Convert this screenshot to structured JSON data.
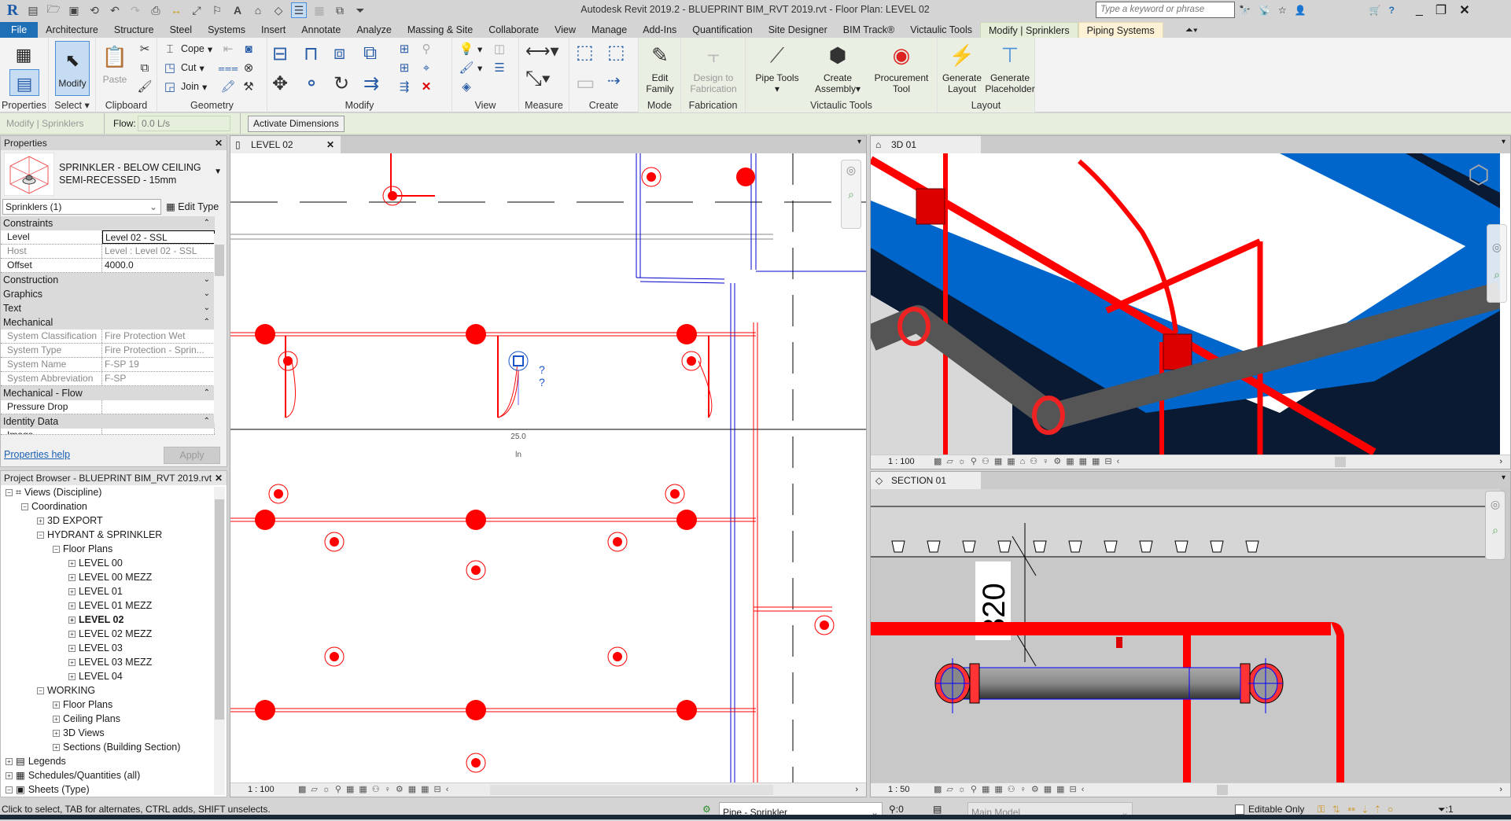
{
  "app": {
    "title": "Autodesk Revit 2019.2 - BLUEPRINT BIM_RVT 2019.rvt - Floor Plan: LEVEL 02",
    "search_placeholder": "Type a keyword or phrase"
  },
  "tabs": [
    "File",
    "Architecture",
    "Structure",
    "Steel",
    "Systems",
    "Insert",
    "Annotate",
    "Analyze",
    "Massing & Site",
    "Collaborate",
    "View",
    "Manage",
    "Add-Ins",
    "Quantification",
    "Site Designer",
    "BIM Track®",
    "Victaulic Tools",
    "Modify | Sprinklers",
    "Piping Systems"
  ],
  "ribbon": {
    "properties_label": "Properties",
    "modify_label": "Modify",
    "select_label": "Select",
    "paste_label": "Paste",
    "clipboard_label": "Clipboard",
    "cope_label": "Cope",
    "cut_label": "Cut",
    "join_label": "Join",
    "geometry_label": "Geometry",
    "modify_panel_label": "Modify",
    "view_label": "View",
    "measure_label": "Measure",
    "create_label": "Create",
    "edit_family_1": "Edit",
    "edit_family_2": "Family",
    "mode_label": "Mode",
    "design_fab_1": "Design to",
    "design_fab_2": "Fabrication",
    "fabrication_label": "Fabrication",
    "pipe_tools": "Pipe Tools",
    "create_assembly_1": "Create",
    "create_assembly_2": "Assembly",
    "procurement_1": "Procurement",
    "procurement_2": "Tool",
    "victaulic_label": "Victaulic Tools",
    "gen_layout_1": "Generate",
    "gen_layout_2": "Layout",
    "gen_placeholder_1": "Generate",
    "gen_placeholder_2": "Placeholder",
    "layout_label": "Layout"
  },
  "options_bar": {
    "context": "Modify | Sprinklers",
    "flow_label": "Flow:",
    "flow_value": "0.0 L/s",
    "activate_dimensions": "Activate Dimensions"
  },
  "properties": {
    "header": "Properties",
    "type_line1": "SPRINKLER - BELOW CEILING",
    "type_line2": "SEMI-RECESSED - 15mm",
    "selector": "Sprinklers (1)",
    "edit_type": "Edit Type",
    "groups": {
      "constraints": "Constraints",
      "construction": "Construction",
      "graphics": "Graphics",
      "text": "Text",
      "mechanical": "Mechanical",
      "mech_flow": "Mechanical - Flow",
      "identity": "Identity Data"
    },
    "rows": {
      "level_k": "Level",
      "level_v": "Level 02 - SSL",
      "host_k": "Host",
      "host_v": "Level : Level 02 - SSL",
      "offset_k": "Offset",
      "offset_v": "4000.0",
      "sysclass_k": "System Classification",
      "sysclass_v": "Fire Protection Wet",
      "systype_k": "System Type",
      "systype_v": "Fire Protection - Sprin...",
      "sysname_k": "System Name",
      "sysname_v": "F-SP 19",
      "sysabbr_k": "System Abbreviation",
      "sysabbr_v": "F-SP",
      "pdrop_k": "Pressure Drop",
      "pdrop_v": "",
      "image_k": "Image"
    },
    "help": "Properties help",
    "apply": "Apply"
  },
  "browser": {
    "header": "Project Browser - BLUEPRINT BIM_RVT 2019.rvt",
    "nodes": [
      "Views (Discipline)",
      "Coordination",
      "3D EXPORT",
      "HYDRANT & SPRINKLER",
      "Floor Plans",
      "LEVEL 00",
      "LEVEL 00 MEZZ",
      "LEVEL 01",
      "LEVEL 01 MEZZ",
      "LEVEL 02",
      "LEVEL 02 MEZZ",
      "LEVEL 03",
      "LEVEL 03 MEZZ",
      "LEVEL 04",
      "WORKING",
      "Floor Plans",
      "Ceiling Plans",
      "3D Views",
      "Sections (Building Section)",
      "Legends",
      "Schedules/Quantities (all)",
      "Sheets (Type)"
    ]
  },
  "views": {
    "plan": {
      "tab": "LEVEL 02",
      "scale": "1 : 100",
      "tag_value": "25.0",
      "tag_unit": "ln",
      "tag_q": "?"
    },
    "threed": {
      "tab": "3D 01",
      "scale": "1 : 100"
    },
    "section": {
      "tab": "SECTION 01",
      "scale": "1 : 50",
      "dimension": "320"
    }
  },
  "status": {
    "hint": "Click to select, TAB for alternates, CTRL adds, SHIFT unselects.",
    "type": "Pipe - Sprinkler",
    "count": ":0",
    "workset": "Main Model",
    "editable_only": "Editable Only",
    "filter_count": ":1"
  }
}
